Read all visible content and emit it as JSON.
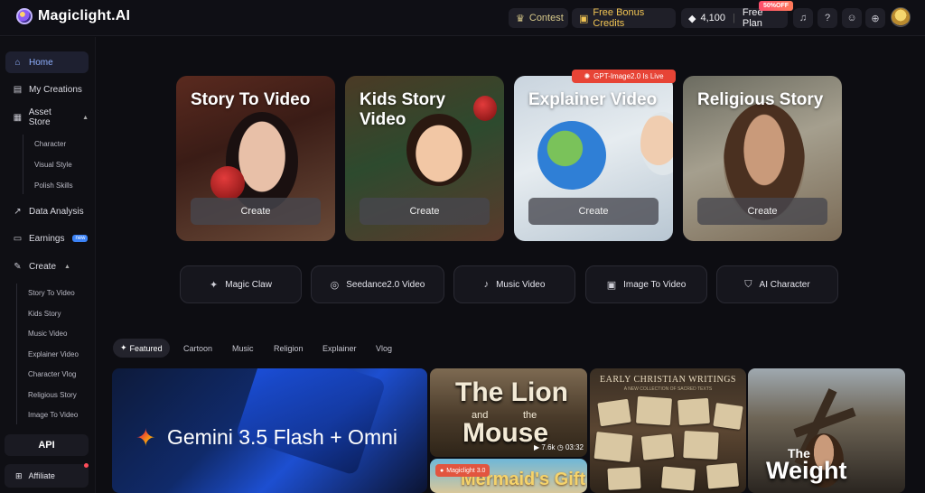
{
  "app": {
    "name": "Magiclight.AI"
  },
  "topbar": {
    "contest": "Contest",
    "bonus": "Free Bonus Credits",
    "credits": "4,100",
    "plan": "Free Plan",
    "discount_badge": "50%OFF",
    "icons": [
      "bell-icon",
      "help-icon",
      "discord-icon",
      "globe-icon"
    ]
  },
  "sidebar": {
    "items": [
      {
        "label": "Home",
        "icon": "home-icon",
        "active": true
      },
      {
        "label": "My Creations",
        "icon": "folder-icon"
      },
      {
        "label": "Asset Store",
        "icon": "store-icon"
      },
      {
        "label": "Data Analysis",
        "icon": "chart-icon"
      },
      {
        "label": "Earnings",
        "icon": "wallet-icon",
        "badge": "new"
      },
      {
        "label": "Create",
        "icon": "create-icon"
      }
    ],
    "asset_sub": [
      "Character",
      "Visual Style",
      "Polish Skills"
    ],
    "create_sub": [
      "Story To Video",
      "Kids Story",
      "Music Video",
      "Explainer Video",
      "Character Vlog",
      "Religious Story",
      "Image To Video"
    ],
    "api": "API",
    "affiliate": "Affiliate"
  },
  "hero_cards": [
    {
      "title": "Story To Video",
      "button": "Create"
    },
    {
      "title": "Kids Story Video",
      "button": "Create"
    },
    {
      "title": "Explainer Video",
      "button": "Create"
    },
    {
      "title": "Religious Story",
      "button": "Create"
    }
  ],
  "gpt_tag": "GPT-Image2.0 Is Live",
  "tools": [
    "Magic Claw",
    "Seedance2.0 Video",
    "Music Video",
    "Image To Video",
    "AI Character"
  ],
  "tabs": [
    "Featured",
    "Cartoon",
    "Music",
    "Religion",
    "Explainer",
    "Vlog"
  ],
  "gallery": {
    "gemini": "Gemini 3.5 Flash + Omni",
    "lion": {
      "title_1": "The Lion",
      "and": "and",
      "the": "the",
      "title_2": "Mouse",
      "views": "7.6k",
      "duration": "03:32"
    },
    "mermaid": {
      "tag": "Magiclight 3.0",
      "title": "Mermaid's Gift"
    },
    "writings": {
      "title": "EARLY CHRISTIAN WRITINGS",
      "subtitle": "A NEW COLLECTION OF SACRED TEXTS"
    },
    "weight": {
      "the": "The",
      "title": "Weight"
    }
  }
}
